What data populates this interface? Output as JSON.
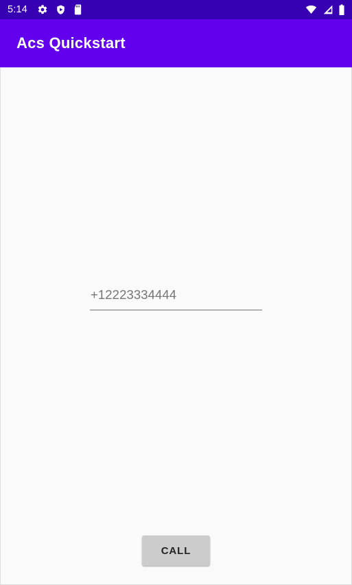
{
  "status_bar": {
    "time": "5:14",
    "left_icons": [
      "settings-gear-icon",
      "play-protect-shield-icon",
      "sd-card-icon"
    ],
    "right_icons": [
      "wifi-icon",
      "cellular-signal-icon",
      "battery-icon"
    ],
    "background_color": "#3700B3",
    "foreground_color": "#FFFFFF"
  },
  "app_bar": {
    "title": "Acs Quickstart",
    "background_color": "#6200EE",
    "title_color": "#FFFFFF"
  },
  "content": {
    "background_color": "#FAFAFA",
    "phone_field": {
      "value": "",
      "placeholder": "+12223334444",
      "placeholder_color": "#757575",
      "underline_color": "#B3B3B3"
    },
    "call_button": {
      "label": "CALL",
      "background_color": "#CCCCCC",
      "text_color": "#232323"
    }
  }
}
